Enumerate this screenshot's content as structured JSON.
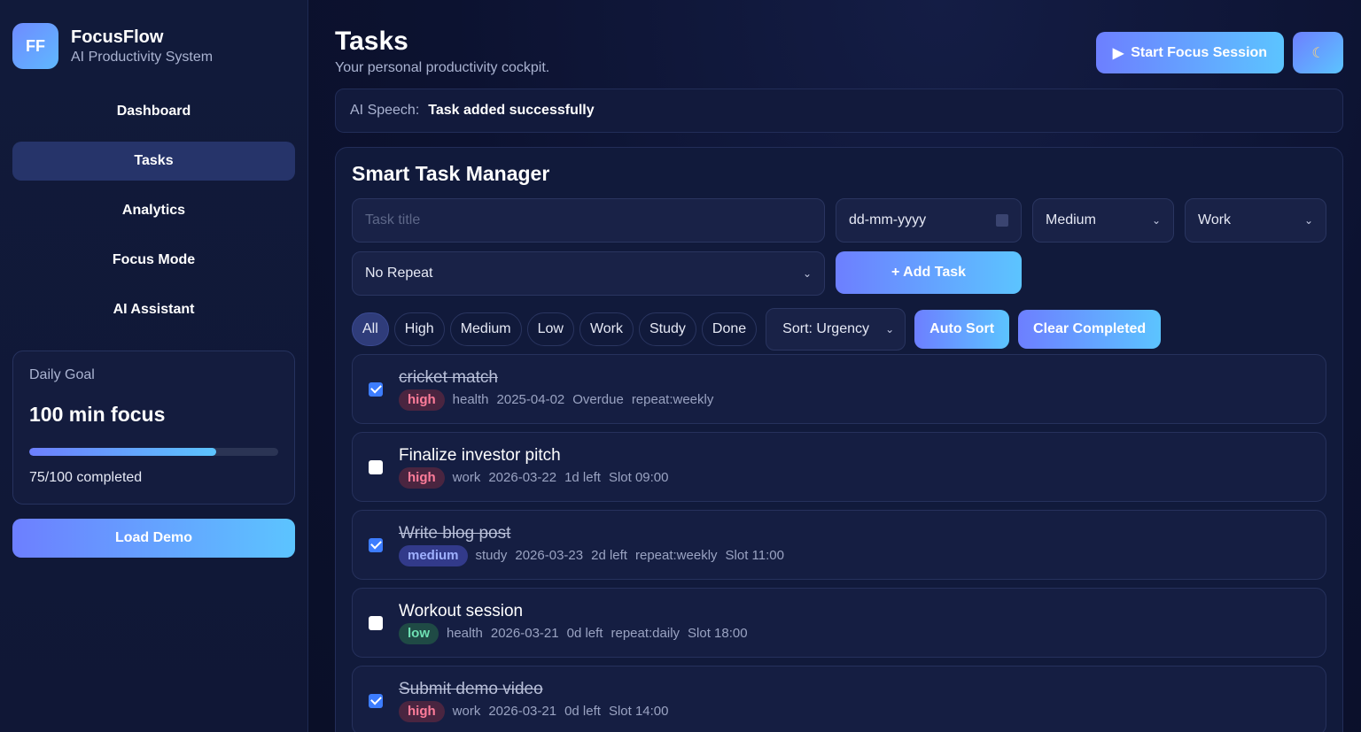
{
  "brand": {
    "logo": "FF",
    "name": "FocusFlow",
    "subtitle": "AI Productivity System"
  },
  "nav": [
    {
      "label": "Dashboard",
      "active": false
    },
    {
      "label": "Tasks",
      "active": true
    },
    {
      "label": "Analytics",
      "active": false
    },
    {
      "label": "Focus Mode",
      "active": false
    },
    {
      "label": "AI Assistant",
      "active": false
    }
  ],
  "goal": {
    "label": "Daily Goal",
    "value": "100 min focus",
    "progress": 0.75,
    "status": "75/100 completed"
  },
  "load_demo": "Load Demo",
  "header": {
    "title": "Tasks",
    "subtitle": "Your personal productivity cockpit.",
    "focus_button": "Start Focus Session",
    "theme_icon": "☾"
  },
  "speech": {
    "label": "AI Speech:",
    "text": "Task added successfully"
  },
  "manager": {
    "title": "Smart Task Manager",
    "title_placeholder": "Task title",
    "date_placeholder": "dd-mm-yyyy",
    "priority_value": "Medium",
    "category_value": "Work",
    "repeat_value": "No Repeat",
    "add_button": "+ Add Task",
    "filters": [
      "All",
      "High",
      "Medium",
      "Low",
      "Work",
      "Study",
      "Done"
    ],
    "sort_value": "Sort: Urgency",
    "auto_sort": "Auto Sort",
    "clear_completed": "Clear Completed"
  },
  "tasks": [
    {
      "title": "cricket match",
      "done": true,
      "priority": "high",
      "category": "health",
      "date": "2025-04-02",
      "due": "Overdue",
      "extra": [
        "repeat:weekly"
      ]
    },
    {
      "title": "Finalize investor pitch",
      "done": false,
      "priority": "high",
      "category": "work",
      "date": "2026-03-22",
      "due": "1d left",
      "extra": [
        "Slot 09:00"
      ]
    },
    {
      "title": "Write blog post",
      "done": true,
      "priority": "medium",
      "category": "study",
      "date": "2026-03-23",
      "due": "2d left",
      "extra": [
        "repeat:weekly",
        "Slot 11:00"
      ]
    },
    {
      "title": "Workout session",
      "done": false,
      "priority": "low",
      "category": "health",
      "date": "2026-03-21",
      "due": "0d left",
      "extra": [
        "repeat:daily",
        "Slot 18:00"
      ]
    },
    {
      "title": "Submit demo video",
      "done": true,
      "priority": "high",
      "category": "work",
      "date": "2026-03-21",
      "due": "0d left",
      "extra": [
        "Slot 14:00"
      ]
    }
  ],
  "colors": {
    "accent_start": "#6d7fff",
    "accent_end": "#5cc4ff",
    "high": "#ff7d9a",
    "medium": "#9fb0ff",
    "low": "#6ee0b3"
  }
}
